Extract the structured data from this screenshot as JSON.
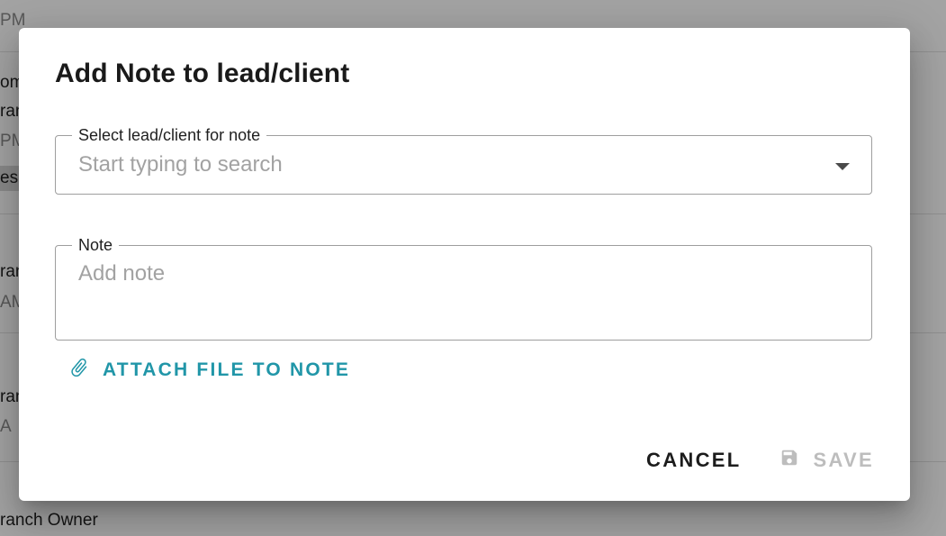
{
  "background": {
    "texts": [
      {
        "text": "PM",
        "grey": true
      },
      {
        "text": "om",
        "grey": false
      },
      {
        "text": "ran",
        "grey": false
      },
      {
        "text": "PM",
        "grey": true
      },
      {
        "text": "es",
        "grey": false
      },
      {
        "text": "ran",
        "grey": false
      },
      {
        "text": "AM",
        "grey": true
      },
      {
        "text": "ran",
        "grey": false
      },
      {
        "text": " A",
        "grey": true
      },
      {
        "text": "ranch Owner",
        "grey": false
      }
    ]
  },
  "dialog": {
    "title": "Add Note to lead/client",
    "lead_field": {
      "label": "Select lead/client for note",
      "placeholder": "Start typing to search",
      "value": ""
    },
    "note_field": {
      "label": "Note",
      "placeholder": "Add note",
      "value": ""
    },
    "attach_label": "ATTACH FILE TO NOTE",
    "cancel_label": "CANCEL",
    "save_label": "SAVE",
    "colors": {
      "accent": "#2196a8",
      "disabled": "#bdbdbd"
    },
    "icons": {
      "attach": "paperclip-icon",
      "save": "floppy-disk-icon",
      "dropdown": "caret-down-icon"
    }
  }
}
